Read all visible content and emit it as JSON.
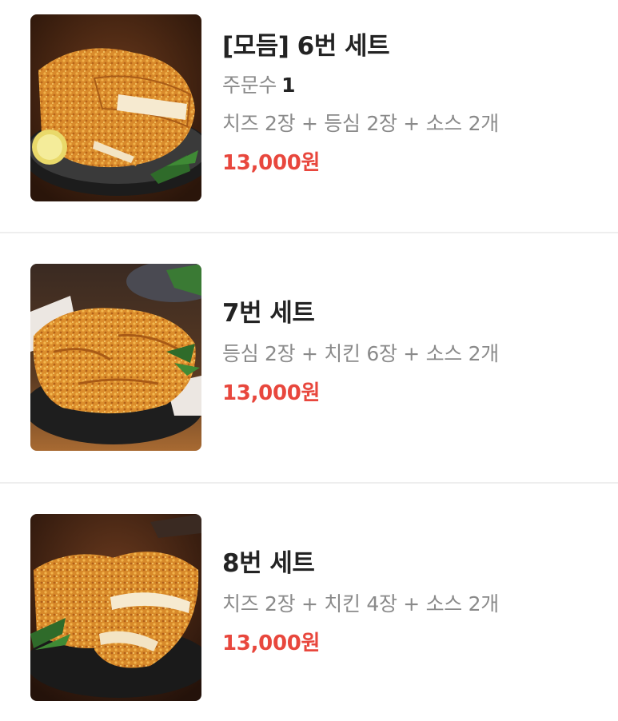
{
  "items": [
    {
      "title": "[모듬] 6번 세트",
      "order_label": "주문수",
      "order_count": "1",
      "description": "치즈 2장 + 등심 2장 + 소스 2개",
      "price": "13,000원",
      "image_icon": "fried-cutlet-platter-image"
    },
    {
      "title": "7번 세트",
      "description": "등심 2장 + 치킨 6장 + 소스 2개",
      "price": "13,000원",
      "image_icon": "fried-cutlet-platter-image"
    },
    {
      "title": "8번 세트",
      "description": "치즈 2장 + 치킨 4장 + 소스 2개",
      "price": "13,000원",
      "image_icon": "fried-cutlet-platter-image"
    }
  ],
  "colors": {
    "title": "#232323",
    "secondary_text": "#8a8a8a",
    "price": "#e8473d",
    "divider": "#eeeeee"
  }
}
